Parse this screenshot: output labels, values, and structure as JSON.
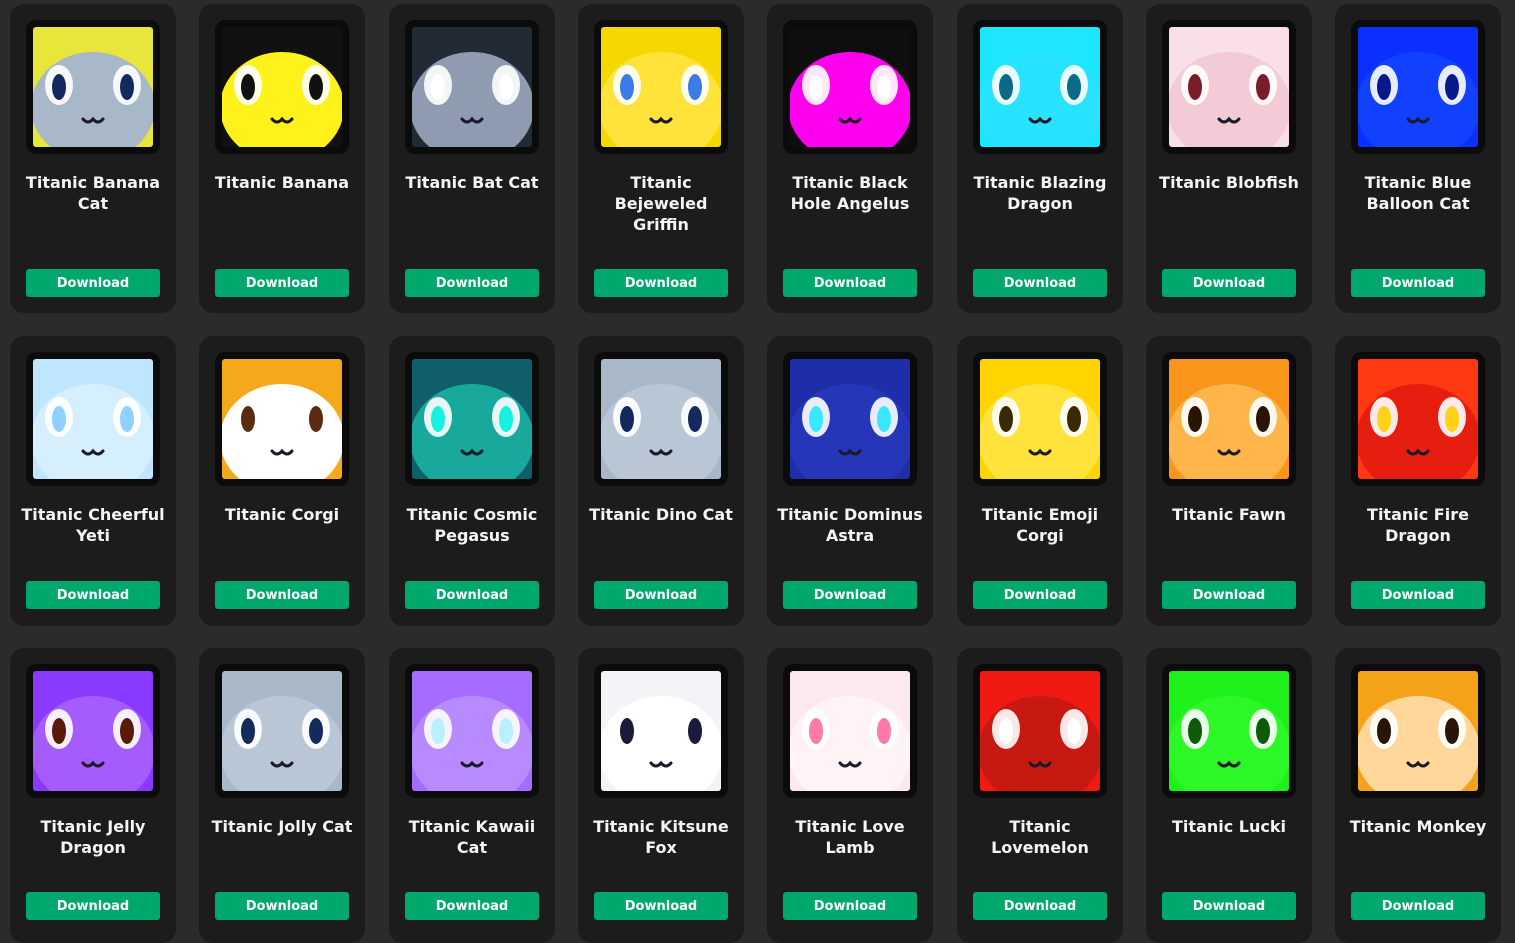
{
  "download_label": "Download",
  "items": [
    {
      "name": "Titanic Banana Cat",
      "icon": "cat-face-icon",
      "bg": "#e8e63a",
      "face": "#a9b8c9",
      "eye": "#132a5c"
    },
    {
      "name": "Titanic Banana",
      "icon": "banana-icon",
      "bg": "#111111",
      "face": "#fff21a",
      "eye": "#111111"
    },
    {
      "name": "Titanic Bat Cat",
      "icon": "bat-cat-face-icon",
      "bg": "#222a34",
      "face": "#8e9bb0",
      "eye": "#ffffff"
    },
    {
      "name": "Titanic Bejeweled Griffin",
      "icon": "griffin-face-icon",
      "bg": "#f5d800",
      "face": "#ffe33a",
      "eye": "#3a7be8"
    },
    {
      "name": "Titanic Black Hole Angelus",
      "icon": "black-hole-icon",
      "bg": "#0e0e0e",
      "face": "#ff00ee",
      "eye": "#ffffff"
    },
    {
      "name": "Titanic Blazing Dragon",
      "icon": "dragon-face-icon",
      "bg": "#1de6ff",
      "face": "#27e3ff",
      "eye": "#0a6a88"
    },
    {
      "name": "Titanic Blobfish",
      "icon": "blobfish-face-icon",
      "bg": "#f9dfe6",
      "face": "#f3cbd6",
      "eye": "#7a1c2a"
    },
    {
      "name": "Titanic Blue Balloon Cat",
      "icon": "balloon-cat-face-icon",
      "bg": "#0b2fff",
      "face": "#1140ff",
      "eye": "#061a8a"
    },
    {
      "name": "Titanic Cheerful Yeti",
      "icon": "yeti-face-icon",
      "bg": "#bfe6ff",
      "face": "#d6efff",
      "eye": "#8fd0ff"
    },
    {
      "name": "Titanic Corgi",
      "icon": "corgi-face-icon",
      "bg": "#f3a91b",
      "face": "#ffffff",
      "eye": "#5a2a12"
    },
    {
      "name": "Titanic Cosmic Pegasus",
      "icon": "pegasus-face-icon",
      "bg": "#0f5f6a",
      "face": "#19a89c",
      "eye": "#16f2e0"
    },
    {
      "name": "Titanic Dino Cat",
      "icon": "cat-face-icon",
      "bg": "#a9b8c9",
      "face": "#b8c6d6",
      "eye": "#132a5c"
    },
    {
      "name": "Titanic Dominus Astra",
      "icon": "dominus-face-icon",
      "bg": "#1e2ea8",
      "face": "#2536b8",
      "eye": "#38e8ff"
    },
    {
      "name": "Titanic Emoji Corgi",
      "icon": "emoji-corgi-face-icon",
      "bg": "#ffd400",
      "face": "#ffe23a",
      "eye": "#3a2a08"
    },
    {
      "name": "Titanic Fawn",
      "icon": "fawn-face-icon",
      "bg": "#f7961a",
      "face": "#ffb54a",
      "eye": "#2a1408"
    },
    {
      "name": "Titanic Fire Dragon",
      "icon": "fire-dragon-face-icon",
      "bg": "#ff3a12",
      "face": "#e61e10",
      "eye": "#ffd21a"
    },
    {
      "name": "Titanic Jelly Dragon",
      "icon": "jelly-dragon-face-icon",
      "bg": "#8a3aff",
      "face": "#a45cff",
      "eye": "#5a1a08"
    },
    {
      "name": "Titanic Jolly Cat",
      "icon": "jolly-cat-face-icon",
      "bg": "#a9b8c9",
      "face": "#b8c6d6",
      "eye": "#132a5c"
    },
    {
      "name": "Titanic Kawaii Cat",
      "icon": "kawaii-cat-face-icon",
      "bg": "#a46cff",
      "face": "#b88aff",
      "eye": "#b8f0ff"
    },
    {
      "name": "Titanic Kitsune Fox",
      "icon": "kitsune-fox-face-icon",
      "bg": "#f4f4f8",
      "face": "#ffffff",
      "eye": "#1a1a3a"
    },
    {
      "name": "Titanic Love Lamb",
      "icon": "lamb-face-icon",
      "bg": "#fbe9ee",
      "face": "#fff3f6",
      "eye": "#ff7aa8"
    },
    {
      "name": "Titanic Lovemelon",
      "icon": "lovemelon-face-icon",
      "bg": "#f01a12",
      "face": "#c81812",
      "eye": "#ffffff"
    },
    {
      "name": "Titanic Lucki",
      "icon": "lucki-face-icon",
      "bg": "#1ef01a",
      "face": "#2cf828",
      "eye": "#0e5a0a"
    },
    {
      "name": "Titanic Monkey",
      "icon": "monkey-face-icon",
      "bg": "#f3a21a",
      "face": "#ffd79a",
      "eye": "#2a1408"
    }
  ]
}
